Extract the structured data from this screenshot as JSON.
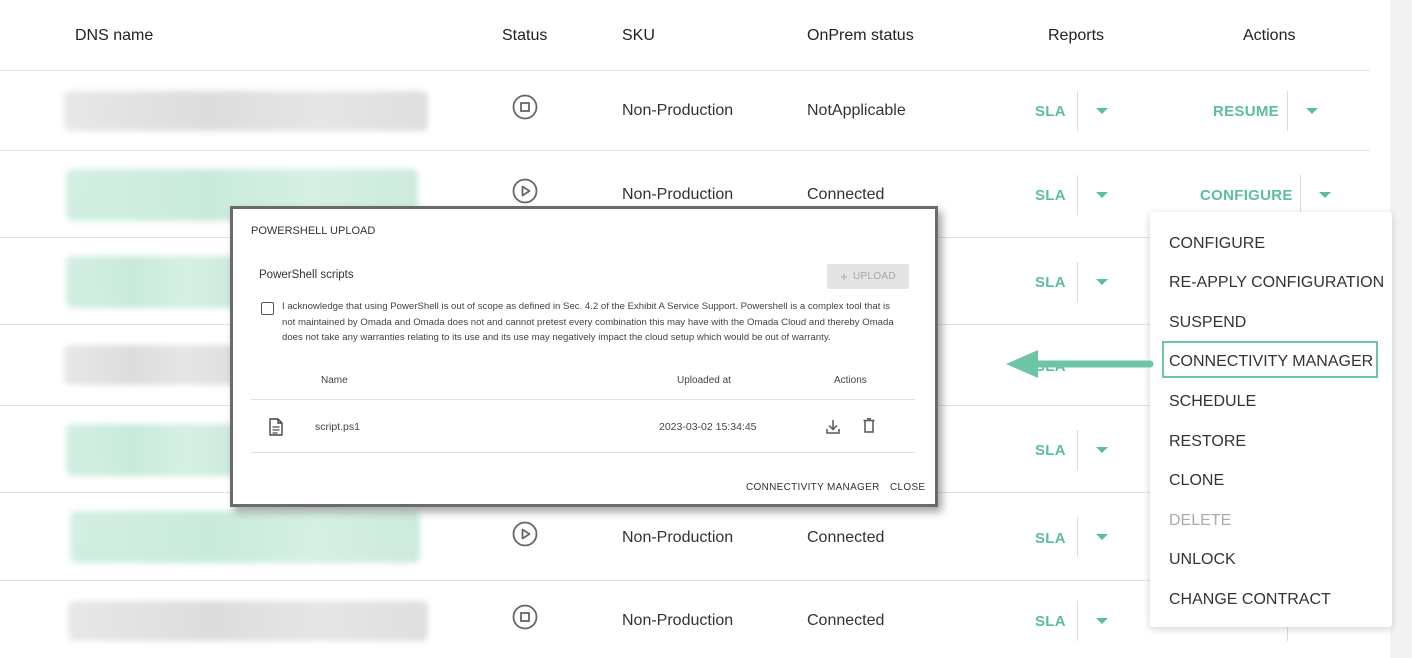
{
  "table": {
    "headers": {
      "dns_name": "DNS name",
      "status": "Status",
      "sku": "SKU",
      "onprem_status": "OnPrem status",
      "reports": "Reports",
      "actions": "Actions"
    },
    "rows": [
      {
        "status_icon": "stop-circle-icon",
        "sku": "Non-Production",
        "onprem": "NotApplicable",
        "report": "SLA",
        "action": "RESUME"
      },
      {
        "status_icon": "play-circle-icon",
        "sku": "Non-Production",
        "onprem": "Connected",
        "report": "SLA",
        "action": "CONFIGURE"
      },
      {
        "report": "SLA"
      },
      {
        "report": "SLA"
      },
      {
        "report": "SLA"
      },
      {
        "status_icon": "play-circle-icon",
        "sku": "Non-Production",
        "onprem": "Connected",
        "report": "SLA"
      },
      {
        "status_icon": "stop-circle-icon",
        "sku": "Non-Production",
        "onprem": "Connected",
        "report": "SLA"
      }
    ]
  },
  "menu": {
    "items": [
      {
        "label": "CONFIGURE",
        "disabled": false
      },
      {
        "label": "RE-APPLY CONFIGURATION",
        "disabled": false
      },
      {
        "label": "SUSPEND",
        "disabled": false
      },
      {
        "label": "CONNECTIVITY MANAGER",
        "disabled": false,
        "highlighted": true
      },
      {
        "label": "SCHEDULE",
        "disabled": false
      },
      {
        "label": "RESTORE",
        "disabled": false
      },
      {
        "label": "CLONE",
        "disabled": false
      },
      {
        "label": "DELETE",
        "disabled": true
      },
      {
        "label": "UNLOCK",
        "disabled": false
      },
      {
        "label": "CHANGE CONTRACT",
        "disabled": false
      }
    ]
  },
  "modal": {
    "title": "POWERSHELL UPLOAD",
    "section_title": "PowerShell scripts",
    "upload_label": "UPLOAD",
    "acknowledgement": "I acknowledge that using PowerShell is out of scope as defined in Sec. 4.2 of the Exhibit A Service Support. Powershell is a complex tool that is not maintained by Omada and Omada does not and cannot pretest every combination this may have with the Omada Cloud and thereby Omada does not take any warranties relating to its use and its use may negatively impact the cloud setup which would be out of warranty.",
    "acknowledged": false,
    "columns": {
      "name": "Name",
      "uploaded_at": "Uploaded at",
      "actions": "Actions"
    },
    "files": [
      {
        "name": "script.ps1",
        "uploaded_at": "2023-03-02 15:34:45"
      }
    ],
    "footer": {
      "connectivity_manager": "CONNECTIVITY MANAGER",
      "close": "CLOSE"
    }
  },
  "colors": {
    "accent": "#5bbf99",
    "highlight_border": "#6cc5a3",
    "disabled": "#aaaaaa"
  }
}
